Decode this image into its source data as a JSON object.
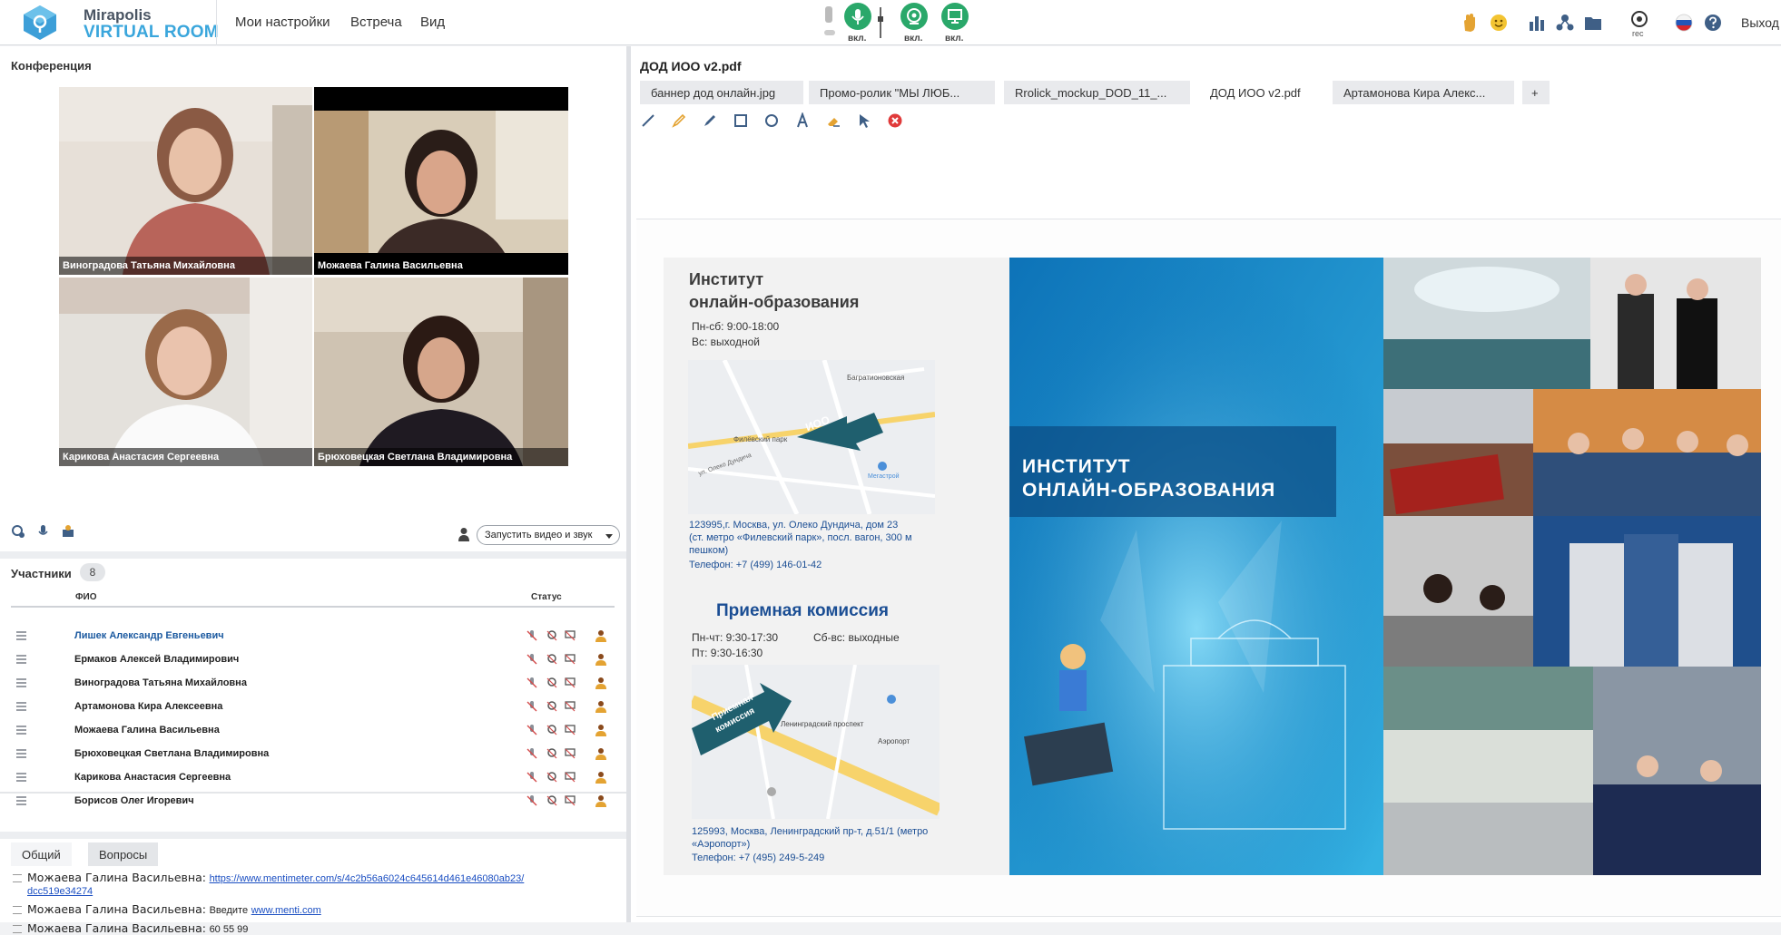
{
  "brand": {
    "name_top": "Mirapolis",
    "name_bottom": "VIRTUAL ROOM"
  },
  "menu": [
    "Мои настройки",
    "Встреча",
    "Вид"
  ],
  "controls": [
    {
      "name": "microphone",
      "label": "вкл."
    },
    {
      "name": "camera",
      "label": "вкл."
    },
    {
      "name": "screen",
      "label": "вкл."
    }
  ],
  "toolbar_right": {
    "rec_label": "rec",
    "exit_label": "Выход"
  },
  "conference": {
    "title": "Конференция",
    "videos": [
      "Виноградова Татьяна Михайловна",
      "Можаева Галина Васильевна",
      "Карикова Анастасия Сергеевна",
      "Брюховецкая Светлана Владимировна"
    ],
    "start_av_label": "Запустить видео и звук"
  },
  "participants": {
    "title": "Участники",
    "count": "8",
    "col_name": "ФИО",
    "col_status": "Статус",
    "rows": [
      {
        "name": "Лишек Александр  Евгеньевич",
        "me": true
      },
      {
        "name": "Ермаков Алексей Владимирович",
        "me": false
      },
      {
        "name": "Виноградова Татьяна Михайловна",
        "me": false
      },
      {
        "name": "Артамонова Кира Алексеевна",
        "me": false
      },
      {
        "name": "Можаева Галина Васильевна",
        "me": false
      },
      {
        "name": "Брюховецкая Светлана Владимировна",
        "me": false
      },
      {
        "name": "Карикова Анастасия Сергеевна",
        "me": false
      },
      {
        "name": "Борисов Олег Игоревич",
        "me": false
      }
    ]
  },
  "chat": {
    "tabs": [
      "Общий",
      "Вопросы"
    ],
    "messages": [
      {
        "sender": "Можаева Галина Васильевна:",
        "link1": "https://www.mentimeter.com/s/4c2b56a6024c645614d461e46080ab23/",
        "link2": "dcc519e34274"
      },
      {
        "sender": "Можаева Галина Васильевна:",
        "text": "Введите",
        "link": "www.menti.com"
      },
      {
        "sender": "Можаева Галина Васильевна:",
        "text": "60 55 99"
      }
    ]
  },
  "document": {
    "title": "ДОД ИОО v2.pdf",
    "tabs": [
      "баннер дод онлайн.jpg",
      "Промо-ролик \"МЫ ЛЮБ...",
      "Rrolick_mockup_DOD_11_...",
      "ДОД ИОО v2.pdf",
      "Артамонова Кира Алекс...",
      "+"
    ],
    "active_tab": 3
  },
  "slide": {
    "institute_title_1": "Институт",
    "institute_title_2": "онлайн-образования",
    "hours_1": "Пн-сб: 9:00-18:00",
    "hours_2": "Вс: выходной",
    "map1_label": "ИОО",
    "map1_station": "Багратионовская",
    "map1_park": "Филёвский парк",
    "map1_street": "ул. Олеко Дундича",
    "map1_megastore": "Мегастрой",
    "address_1": "123995,г. Москва, ул. Олеко Дундича, дом 23",
    "address_2": "(ст. метро «Филевский парк», посл. вагон, 300 м",
    "address_3": "пешком)",
    "phone_1": "Телефон: +7 (499) 146-01-42",
    "admission_title": "Приемная комиссия",
    "adm_hours_1": "Пн-чт: 9:30-17:30",
    "adm_hours_2": "Сб-вс: выходные",
    "adm_hours_3": "Пт: 9:30-16:30",
    "map2_label_1": "Приемная",
    "map2_label_2": "комиссия",
    "map2_prospect": "Ленинградский проспект",
    "map2_airport": "Аэропорт",
    "address_4": "125993, Москва, Ленинградский пр-т, д.51/1 (метро",
    "address_5": "«Аэропорт»)",
    "phone_2": "Телефон: +7 (495) 249-5-249",
    "banner_title_1": "ИНСТИТУТ",
    "banner_title_2": "ОНЛАЙН-ОБРАЗОВАНИЯ"
  },
  "colors": {
    "accent_green": "#2aa86a",
    "brand_blue": "#3aa6dc",
    "link_blue": "#1a4ec2",
    "banner_blue": "#1487c4"
  }
}
